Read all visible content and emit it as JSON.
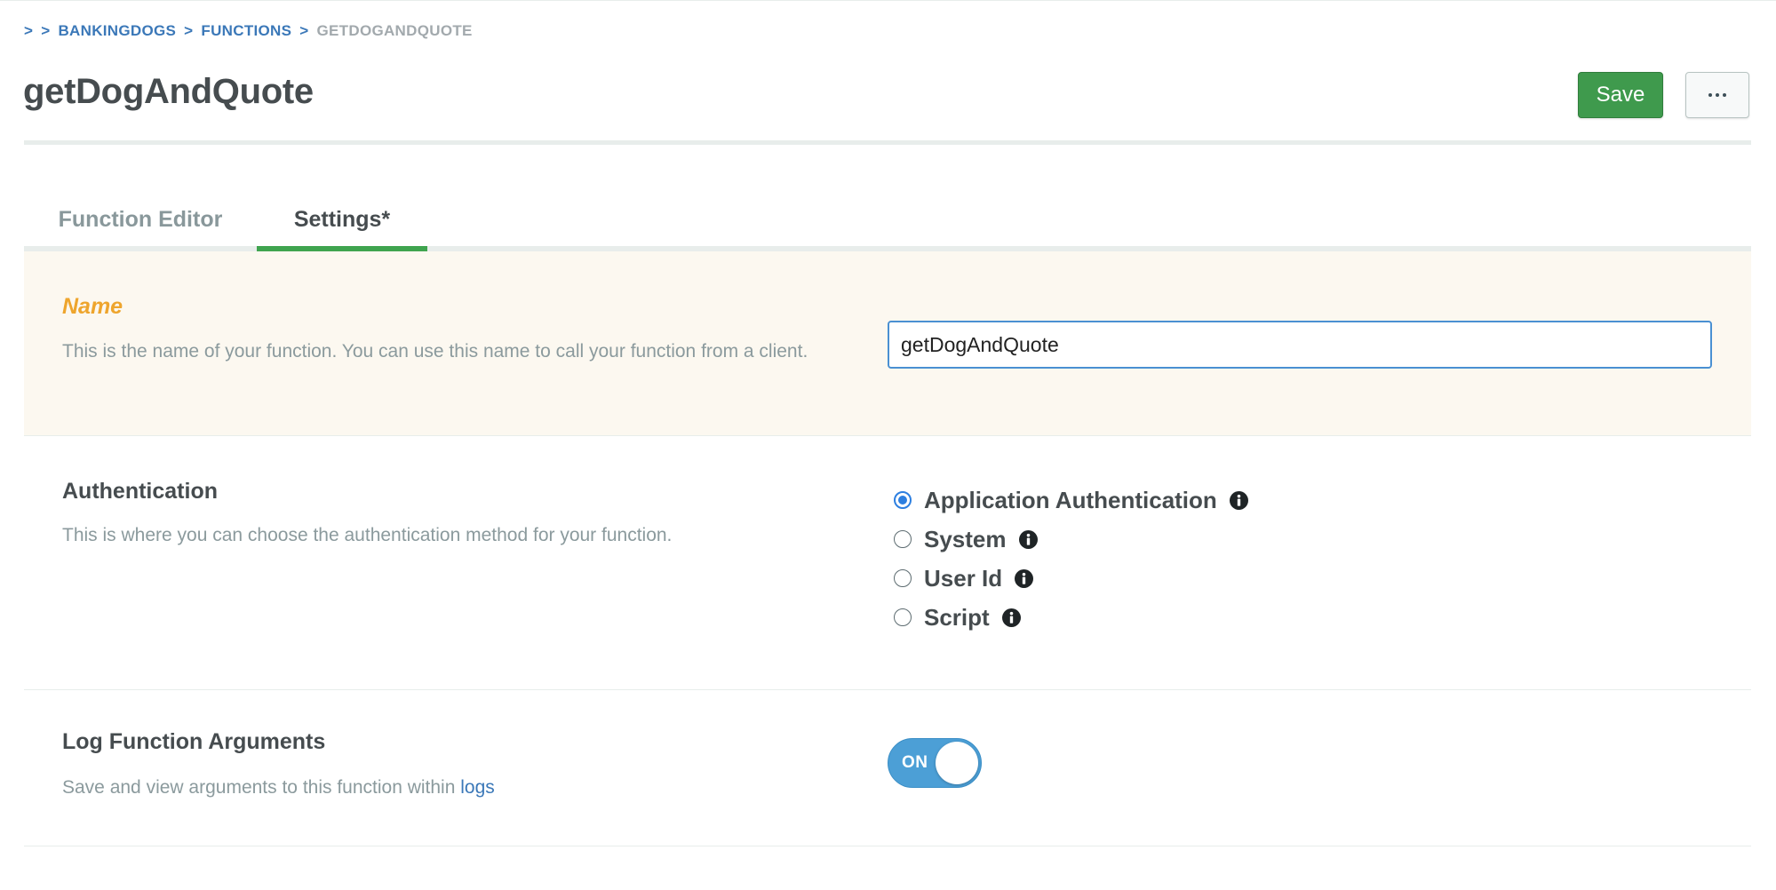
{
  "breadcrumb": {
    "sep": ">",
    "items": [
      "BANKINGDOGS",
      "FUNCTIONS"
    ],
    "current": "GETDOGANDQUOTE"
  },
  "header": {
    "title": "getDogAndQuote",
    "save_label": "Save",
    "more_icon": "more-horizontal-icon"
  },
  "tabs": [
    {
      "label": "Function Editor",
      "active": false
    },
    {
      "label": "Settings*",
      "active": true
    }
  ],
  "name_section": {
    "label": "Name",
    "description": "This is the name of your function. You can use this name to call your function from a client.",
    "input_value": "getDogAndQuote "
  },
  "auth_section": {
    "title": "Authentication",
    "description": "This is where you can choose the authentication method for your function.",
    "options": [
      {
        "label": "Application Authentication",
        "selected": true,
        "icon": "info-icon"
      },
      {
        "label": "System",
        "selected": false,
        "icon": "info-icon"
      },
      {
        "label": "User Id",
        "selected": false,
        "icon": "info-icon"
      },
      {
        "label": "Script",
        "selected": false,
        "icon": "info-icon"
      }
    ]
  },
  "log_section": {
    "title": "Log Function Arguments",
    "description": "Save and view arguments to this function within",
    "link_text": "logs",
    "toggle_label": "ON",
    "toggle_on": true
  },
  "colors": {
    "accent_blue": "#3b78b8",
    "save_green": "#3f9a4d",
    "tab_active_green": "#3fa44f",
    "name_label_orange": "#eea52d",
    "toggle_blue": "#4c9fd6"
  }
}
